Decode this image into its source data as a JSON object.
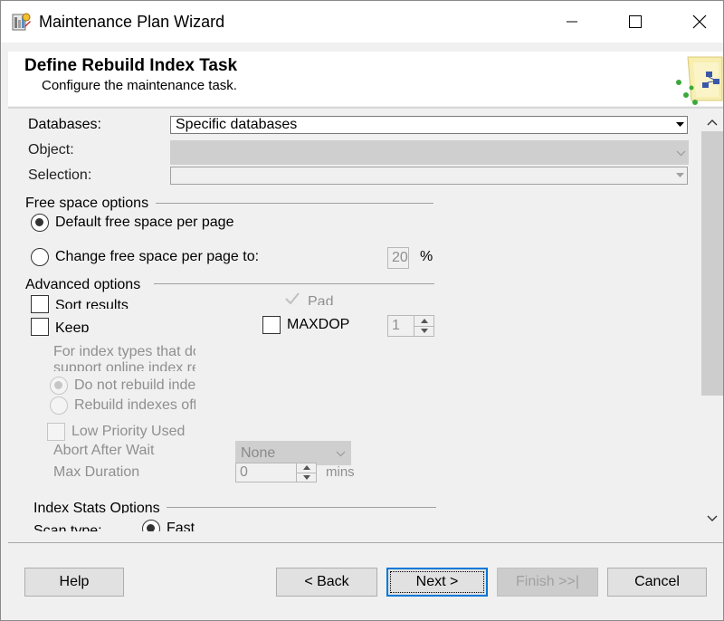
{
  "window": {
    "title": "Maintenance Plan Wizard"
  },
  "header": {
    "title": "Define Rebuild Index Task",
    "subtitle": "Configure the maintenance task."
  },
  "form": {
    "databases_label": "Databases:",
    "databases_value": "Specific databases",
    "object_label": "Object:",
    "object_value": "",
    "selection_label": "Selection:",
    "selection_value": ""
  },
  "free_space": {
    "group_label": "Free space options",
    "default_label": "Default free space per page",
    "change_label": "Change free space per page to:",
    "change_value": "20",
    "percent_sign": "%"
  },
  "advanced": {
    "group_label": "Advanced options",
    "sort_results_label": "Sort results",
    "keep_label": "Keep",
    "pad_label": "Pad",
    "maxdop_label": "MAXDOP",
    "maxdop_value": "1",
    "online_note_line1": "For index types that do",
    "online_note_line2": "support online index re",
    "do_not_rebuild_label": "Do not rebuild inde",
    "rebuild_offline_label": "Rebuild indexes off",
    "low_priority_label": "Low Priority Used",
    "abort_after_wait_label": "Abort After Wait",
    "abort_after_wait_value": "None",
    "max_duration_label": "Max Duration",
    "max_duration_value": "0",
    "mins_label": "mins"
  },
  "index_stats": {
    "group_label": "Index Stats Options",
    "scan_type_label": "Scan type:",
    "fast_label": "Fast"
  },
  "buttons": {
    "help": "Help",
    "back": "< Back",
    "next": "Next >",
    "finish": "Finish >>|",
    "cancel": "Cancel"
  }
}
